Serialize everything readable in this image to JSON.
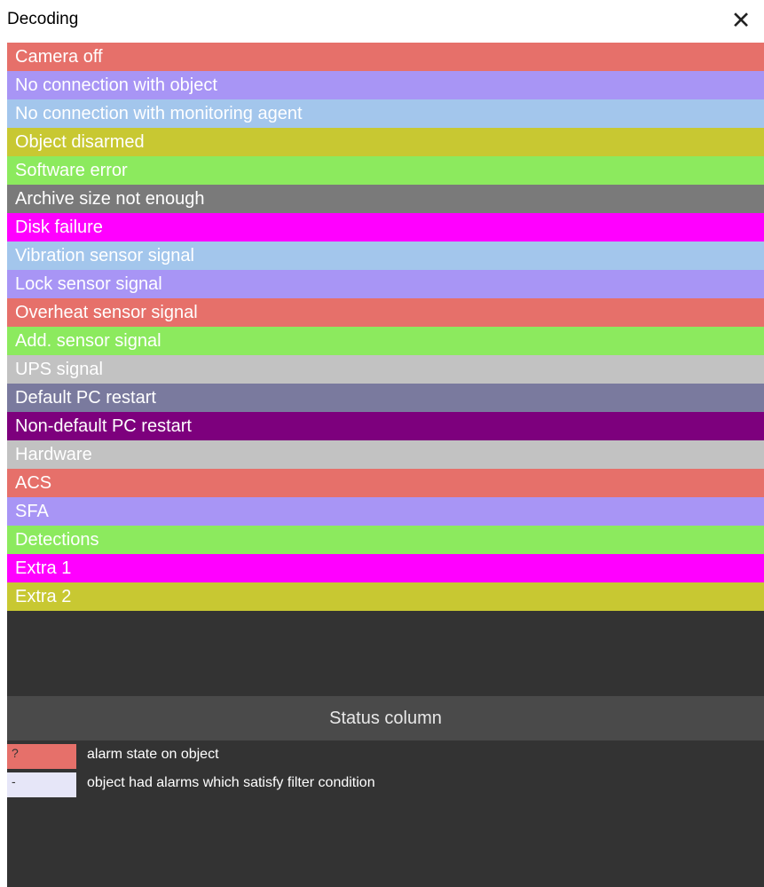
{
  "window": {
    "title": "Decoding",
    "close_icon": "close-icon"
  },
  "decoding_items": [
    {
      "label": "Camera off",
      "color": "#e6706a"
    },
    {
      "label": "No connection with object",
      "color": "#a895f5"
    },
    {
      "label": "No connection with monitoring agent",
      "color": "#a3c6ec"
    },
    {
      "label": "Object disarmed",
      "color": "#c8c832"
    },
    {
      "label": "Software error",
      "color": "#8cea5e"
    },
    {
      "label": "Archive size not enough",
      "color": "#7a7a7a"
    },
    {
      "label": "Disk failure",
      "color": "#ff00ff"
    },
    {
      "label": "Vibration sensor signal",
      "color": "#a3c6ec"
    },
    {
      "label": "Lock sensor signal",
      "color": "#a895f5"
    },
    {
      "label": "Overheat sensor signal",
      "color": "#e6706a"
    },
    {
      "label": "Add. sensor signal",
      "color": "#8cea5e"
    },
    {
      "label": "UPS signal",
      "color": "#c2c2c2"
    },
    {
      "label": "Default PC restart",
      "color": "#7a7a9e"
    },
    {
      "label": "Non-default PC restart",
      "color": "#7d007d"
    },
    {
      "label": "Hardware",
      "color": "#c2c2c2"
    },
    {
      "label": "ACS",
      "color": "#e6706a"
    },
    {
      "label": "SFA",
      "color": "#a895f5"
    },
    {
      "label": "Detections",
      "color": "#8cea5e"
    },
    {
      "label": "Extra 1",
      "color": "#ff00ff"
    },
    {
      "label": "Extra 2",
      "color": "#c8c832"
    }
  ],
  "status_column": {
    "header": "Status column",
    "legend": [
      {
        "symbol": "?",
        "swatch_color": "#e6706a",
        "symbol_color": "#333333",
        "description": "alarm state on object"
      },
      {
        "symbol": "-",
        "swatch_color": "#e6e6f8",
        "symbol_color": "#333333",
        "description": "object had alarms which satisfy filter condition"
      }
    ]
  }
}
